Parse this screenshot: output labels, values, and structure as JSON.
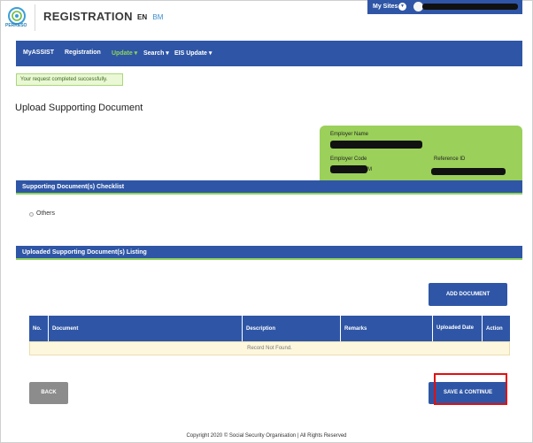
{
  "header": {
    "logo_text": "PERKESO",
    "app_title": "REGISTRATION",
    "lang_en": "EN",
    "lang_bm": "BM",
    "my_sites_label": "My Sites"
  },
  "nav": {
    "items": [
      {
        "label": "MyASSIST"
      },
      {
        "label": "Registration"
      },
      {
        "label": "Update ▾"
      },
      {
        "label": "Search ▾"
      },
      {
        "label": "EIS Update ▾"
      }
    ]
  },
  "alert": {
    "message": "Your request completed successfully."
  },
  "page": {
    "title": "Upload Supporting Document"
  },
  "employer": {
    "name_label": "Employer Name",
    "code_label": "Employer Code",
    "code_suffix": "M",
    "reference_label": "Reference ID"
  },
  "checklist": {
    "title": "Supporting Document(s) Checklist",
    "items": [
      {
        "label": "Others"
      }
    ]
  },
  "listing": {
    "title": "Uploaded Supporting Document(s) Listing",
    "add_button": "ADD DOCUMENT",
    "columns": [
      "No.",
      "Document",
      "Description",
      "Remarks",
      "Uploaded Date",
      "Action"
    ],
    "empty_text": "Record Not Found."
  },
  "actions": {
    "back": "BACK",
    "save": "SAVE & CONTINUE"
  },
  "footer": {
    "text": "Copyright 2020 © Social Security Organisation | All Rights Reserved"
  },
  "colors": {
    "primary": "#2f56a6",
    "accent": "#8fd45a",
    "card": "#9bd05a"
  }
}
